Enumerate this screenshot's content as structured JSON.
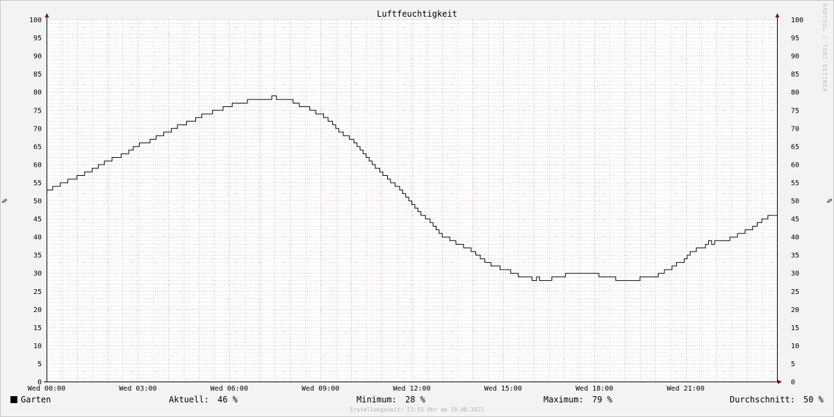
{
  "chart_data": {
    "type": "line",
    "title": "Luftfeuchtigkeit",
    "ylabel": "%",
    "ylim": [
      0,
      100
    ],
    "yticks": [
      0,
      5,
      10,
      15,
      20,
      25,
      30,
      35,
      40,
      45,
      50,
      55,
      60,
      65,
      70,
      75,
      80,
      85,
      90,
      95,
      100
    ],
    "x_range_hours": [
      0,
      24
    ],
    "x_ticks": [
      {
        "h": 0,
        "label": "Wed 00:00"
      },
      {
        "h": 3,
        "label": "Wed 03:00"
      },
      {
        "h": 6,
        "label": "Wed 06:00"
      },
      {
        "h": 9,
        "label": "Wed 09:00"
      },
      {
        "h": 12,
        "label": "Wed 12:00"
      },
      {
        "h": 15,
        "label": "Wed 15:00"
      },
      {
        "h": 18,
        "label": "Wed 18:00"
      },
      {
        "h": 21,
        "label": "Wed 21:00"
      }
    ],
    "grid": true,
    "series": [
      {
        "name": "Garten",
        "color": "#000000",
        "points": [
          [
            0,
            53
          ],
          [
            0.2,
            54
          ],
          [
            0.45,
            55
          ],
          [
            0.7,
            56
          ],
          [
            1.0,
            57
          ],
          [
            1.25,
            58
          ],
          [
            1.5,
            59
          ],
          [
            1.7,
            60
          ],
          [
            1.9,
            61
          ],
          [
            2.15,
            62
          ],
          [
            2.45,
            63
          ],
          [
            2.7,
            64
          ],
          [
            2.85,
            65
          ],
          [
            3.05,
            66
          ],
          [
            3.4,
            67
          ],
          [
            3.6,
            68
          ],
          [
            3.85,
            69
          ],
          [
            4.1,
            70
          ],
          [
            4.3,
            71
          ],
          [
            4.6,
            72
          ],
          [
            4.9,
            73
          ],
          [
            5.1,
            74
          ],
          [
            5.45,
            75
          ],
          [
            5.8,
            76
          ],
          [
            6.1,
            77
          ],
          [
            6.6,
            78
          ],
          [
            7.4,
            79
          ],
          [
            7.55,
            78
          ],
          [
            8.1,
            77
          ],
          [
            8.3,
            76
          ],
          [
            8.65,
            75
          ],
          [
            8.85,
            74
          ],
          [
            9.1,
            73
          ],
          [
            9.25,
            72
          ],
          [
            9.4,
            71
          ],
          [
            9.5,
            70
          ],
          [
            9.6,
            69
          ],
          [
            9.75,
            68
          ],
          [
            9.95,
            67
          ],
          [
            10.1,
            66
          ],
          [
            10.2,
            65
          ],
          [
            10.3,
            64
          ],
          [
            10.4,
            63
          ],
          [
            10.5,
            62
          ],
          [
            10.6,
            61
          ],
          [
            10.7,
            60
          ],
          [
            10.8,
            59
          ],
          [
            10.95,
            58
          ],
          [
            11.05,
            57
          ],
          [
            11.2,
            56
          ],
          [
            11.3,
            55
          ],
          [
            11.45,
            54
          ],
          [
            11.6,
            53
          ],
          [
            11.7,
            52
          ],
          [
            11.8,
            51
          ],
          [
            11.9,
            50
          ],
          [
            12.0,
            49
          ],
          [
            12.1,
            48
          ],
          [
            12.2,
            47
          ],
          [
            12.3,
            46
          ],
          [
            12.45,
            45
          ],
          [
            12.6,
            44
          ],
          [
            12.7,
            43
          ],
          [
            12.8,
            42
          ],
          [
            12.9,
            41
          ],
          [
            13.0,
            40
          ],
          [
            13.25,
            39
          ],
          [
            13.45,
            38
          ],
          [
            13.7,
            37
          ],
          [
            13.95,
            36
          ],
          [
            14.1,
            35
          ],
          [
            14.25,
            34
          ],
          [
            14.4,
            33
          ],
          [
            14.6,
            32
          ],
          [
            14.9,
            31
          ],
          [
            15.25,
            30
          ],
          [
            15.5,
            29
          ],
          [
            15.95,
            28
          ],
          [
            16.1,
            29
          ],
          [
            16.2,
            28
          ],
          [
            16.6,
            29
          ],
          [
            17.05,
            30
          ],
          [
            18.15,
            29
          ],
          [
            18.7,
            28
          ],
          [
            19.5,
            29
          ],
          [
            20.1,
            30
          ],
          [
            20.3,
            31
          ],
          [
            20.55,
            32
          ],
          [
            20.7,
            33
          ],
          [
            20.95,
            34
          ],
          [
            21.05,
            35
          ],
          [
            21.15,
            36
          ],
          [
            21.35,
            37
          ],
          [
            21.65,
            38
          ],
          [
            21.75,
            39
          ],
          [
            21.85,
            38
          ],
          [
            21.95,
            39
          ],
          [
            22.45,
            40
          ],
          [
            22.7,
            41
          ],
          [
            22.95,
            42
          ],
          [
            23.2,
            43
          ],
          [
            23.35,
            44
          ],
          [
            23.5,
            45
          ],
          [
            23.7,
            46
          ],
          [
            24,
            46
          ]
        ]
      }
    ]
  },
  "legend": {
    "series_name": "Garten",
    "current_label": "Aktuell:",
    "current_value": "46 %",
    "min_label": "Minimum:",
    "min_value": "28 %",
    "max_label": "Maximum:",
    "max_value": "79 %",
    "avg_label": "Durchschnitt:",
    "avg_value": "50 %"
  },
  "footer_text": "Erstellungszeit: 23:55 Uhr am 10.08.2022",
  "watermark_text": "RRDTOOL / TOBI OETIKER",
  "colors": {
    "background": "#f3f3f3",
    "plot_background": "#ffffff",
    "minor_grid": "#c8c8c8",
    "major_grid": "#e2a5ad",
    "axis": "#000000",
    "arrow": "#8b0000",
    "line": "#000000"
  }
}
